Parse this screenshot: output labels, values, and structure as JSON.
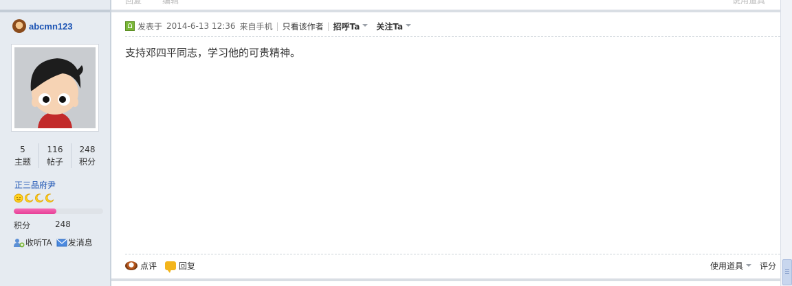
{
  "colors": {
    "accent": "#1a52b3",
    "progress": "#e73f96",
    "post_icon": "#7ab738"
  },
  "top_ghost": {
    "left_items": [
      "回复",
      "编辑"
    ],
    "right": "说用道具"
  },
  "author": {
    "name": "abcmn123",
    "icon": "monkey-face-icon",
    "stats": [
      {
        "value": "5",
        "label": "主题"
      },
      {
        "value": "116",
        "label": "帖子"
      },
      {
        "value": "248",
        "label": "积分"
      }
    ],
    "rank_title": "正三品府尹",
    "rank_icons": [
      "sun-icon",
      "moon-icon",
      "moon-icon",
      "moon-icon"
    ],
    "progress_fraction": 0.48,
    "credit_label": "积分",
    "credit_value": "248",
    "follow_label": "收听TA",
    "message_label": "发消息"
  },
  "post": {
    "posted_prefix": "发表于",
    "date": "2014-6-13 12:36",
    "source": "来自手机",
    "only_author": "只看该作者",
    "greet": "招呼Ta",
    "follow": "关注Ta",
    "content": "支持邓四平同志，学习他的可贵精神。",
    "comment_label": "点评",
    "reply_label": "回复",
    "tools_label": "使用道具",
    "rate_label": "评分"
  }
}
